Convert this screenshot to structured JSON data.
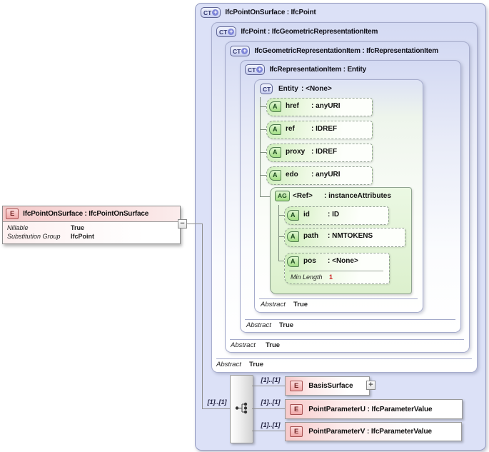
{
  "element_box": {
    "icon": "E",
    "title": "IfcPointOnSurface : IfcPointOnSurface",
    "properties": [
      {
        "label": "Nillable",
        "value": "True"
      },
      {
        "label": "Substitution Group",
        "value": "IfcPoint"
      }
    ],
    "collapse_glyph": "−"
  },
  "ct": [
    {
      "icon": "CT",
      "plus": "+",
      "title": "IfcPointOnSurface : IfcPoint"
    },
    {
      "icon": "CT",
      "plus": "+",
      "title": "IfcPoint : IfcGeometricRepresentationItem",
      "abstract_label": "Abstract",
      "abstract_value": "True"
    },
    {
      "icon": "CT",
      "plus": "+",
      "title": "IfcGeometricRepresentationItem : IfcRepresentationItem",
      "abstract_label": "Abstract",
      "abstract_value": "True"
    },
    {
      "icon": "CT",
      "plus": "+",
      "title": "IfcRepresentationItem : Entity",
      "abstract_label": "Abstract",
      "abstract_value": "True"
    },
    {
      "icon": "CT",
      "name": "Entity",
      "type": ": <None>",
      "abstract_label": "Abstract",
      "abstract_value": "True"
    }
  ],
  "attributes": [
    {
      "icon": "A",
      "name": "href",
      "type": ": anyURI"
    },
    {
      "icon": "A",
      "name": "ref",
      "type": ": IDREF"
    },
    {
      "icon": "A",
      "name": "proxy",
      "type": ": IDREF"
    },
    {
      "icon": "A",
      "name": "edo",
      "type": ": anyURI"
    }
  ],
  "attribute_group": {
    "icon": "AG",
    "name": "<Ref>",
    "type": ": instanceAttributes",
    "attributes": [
      {
        "icon": "A",
        "name": "id",
        "type": ": ID"
      },
      {
        "icon": "A",
        "name": "path",
        "type": ": NMTOKENS"
      },
      {
        "icon": "A",
        "name": "pos",
        "type": ": <None>",
        "facet_label": "Min Length",
        "facet_value": "1"
      }
    ]
  },
  "sequence": {
    "cardinality": "[1]..[1]",
    "children": [
      {
        "icon": "E",
        "cardinality": "[1]..[1]",
        "title": "BasisSurface",
        "expand_glyph": "+"
      },
      {
        "icon": "E",
        "cardinality": "[1]..[1]",
        "title": "PointParameterU : IfcParameterValue"
      },
      {
        "icon": "E",
        "cardinality": "[1]..[1]",
        "title": "PointParameterV : IfcParameterValue"
      }
    ]
  },
  "colors": {
    "lavender_fill": "#dce1f7",
    "green_fill": "#a3de85",
    "pink_fill": "#f0a8a8",
    "facet_red": "#cc2222"
  }
}
